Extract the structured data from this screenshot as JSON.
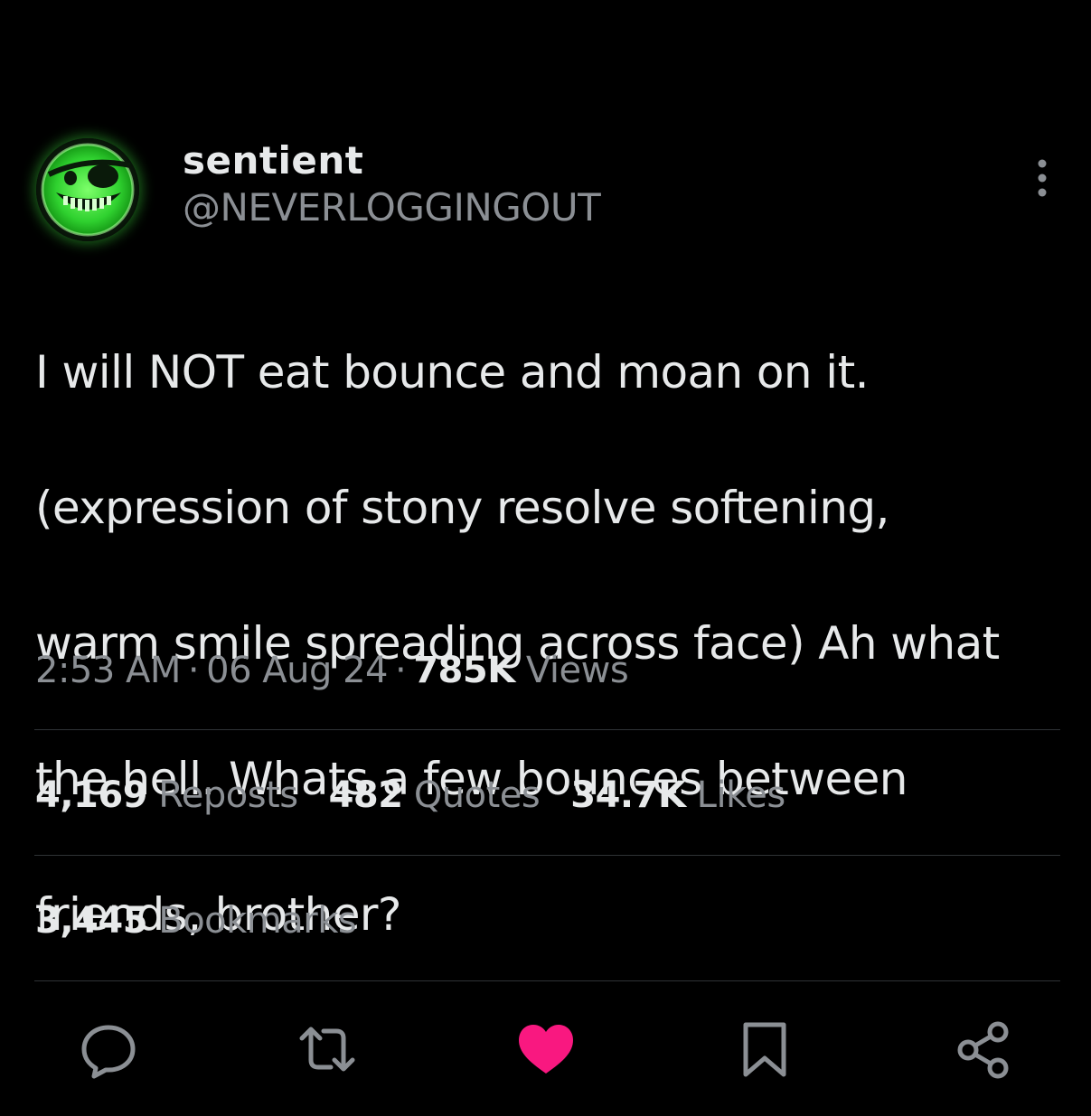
{
  "author": {
    "display_name": "sentient",
    "handle": "@NEVERLOGGINGOUT",
    "avatar_icon": "grinning-eyepatch-face-icon",
    "avatar_color": "#39d339"
  },
  "tweet": {
    "lines": [
      "I will NOT eat bounce and moan on it.",
      "(expression of stony resolve softening,",
      "warm smile spreading across face) Ah what",
      "the hell. Whats a few bounces between",
      "friends, brother?"
    ]
  },
  "meta": {
    "time": "2:53 AM",
    "date": "06 Aug 24",
    "separator": "·",
    "views_count": "785K",
    "views_label": "Views"
  },
  "stats": {
    "reposts_count": "4,169",
    "reposts_label": "Reposts",
    "quotes_count": "482",
    "quotes_label": "Quotes",
    "likes_count": "34.7K",
    "likes_label": "Likes",
    "bookmarks_count": "3,445",
    "bookmarks_label": "Bookmarks"
  },
  "actions": {
    "reply_icon": "reply-icon",
    "repost_icon": "repost-icon",
    "like_icon": "heart-icon",
    "like_active": true,
    "like_color": "#f91880",
    "bookmark_icon": "bookmark-icon",
    "share_icon": "share-icon"
  },
  "colors": {
    "background": "#000000",
    "text_primary": "#e7e9ea",
    "text_secondary": "#8b8f94",
    "divider": "#2f3336"
  }
}
